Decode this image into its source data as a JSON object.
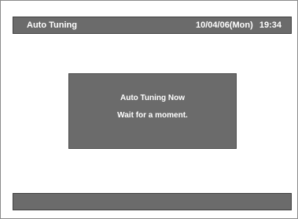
{
  "header": {
    "title": "Auto Tuning",
    "date": "10/04/06(Mon)",
    "time": "19:34"
  },
  "dialog": {
    "line1": "Auto Tuning Now",
    "line2": "Wait for a moment."
  },
  "status_bar": {
    "text": ""
  },
  "colors": {
    "bar_background": "#6b6b6b",
    "text": "#ffffff",
    "screen_background": "#ffffff"
  }
}
